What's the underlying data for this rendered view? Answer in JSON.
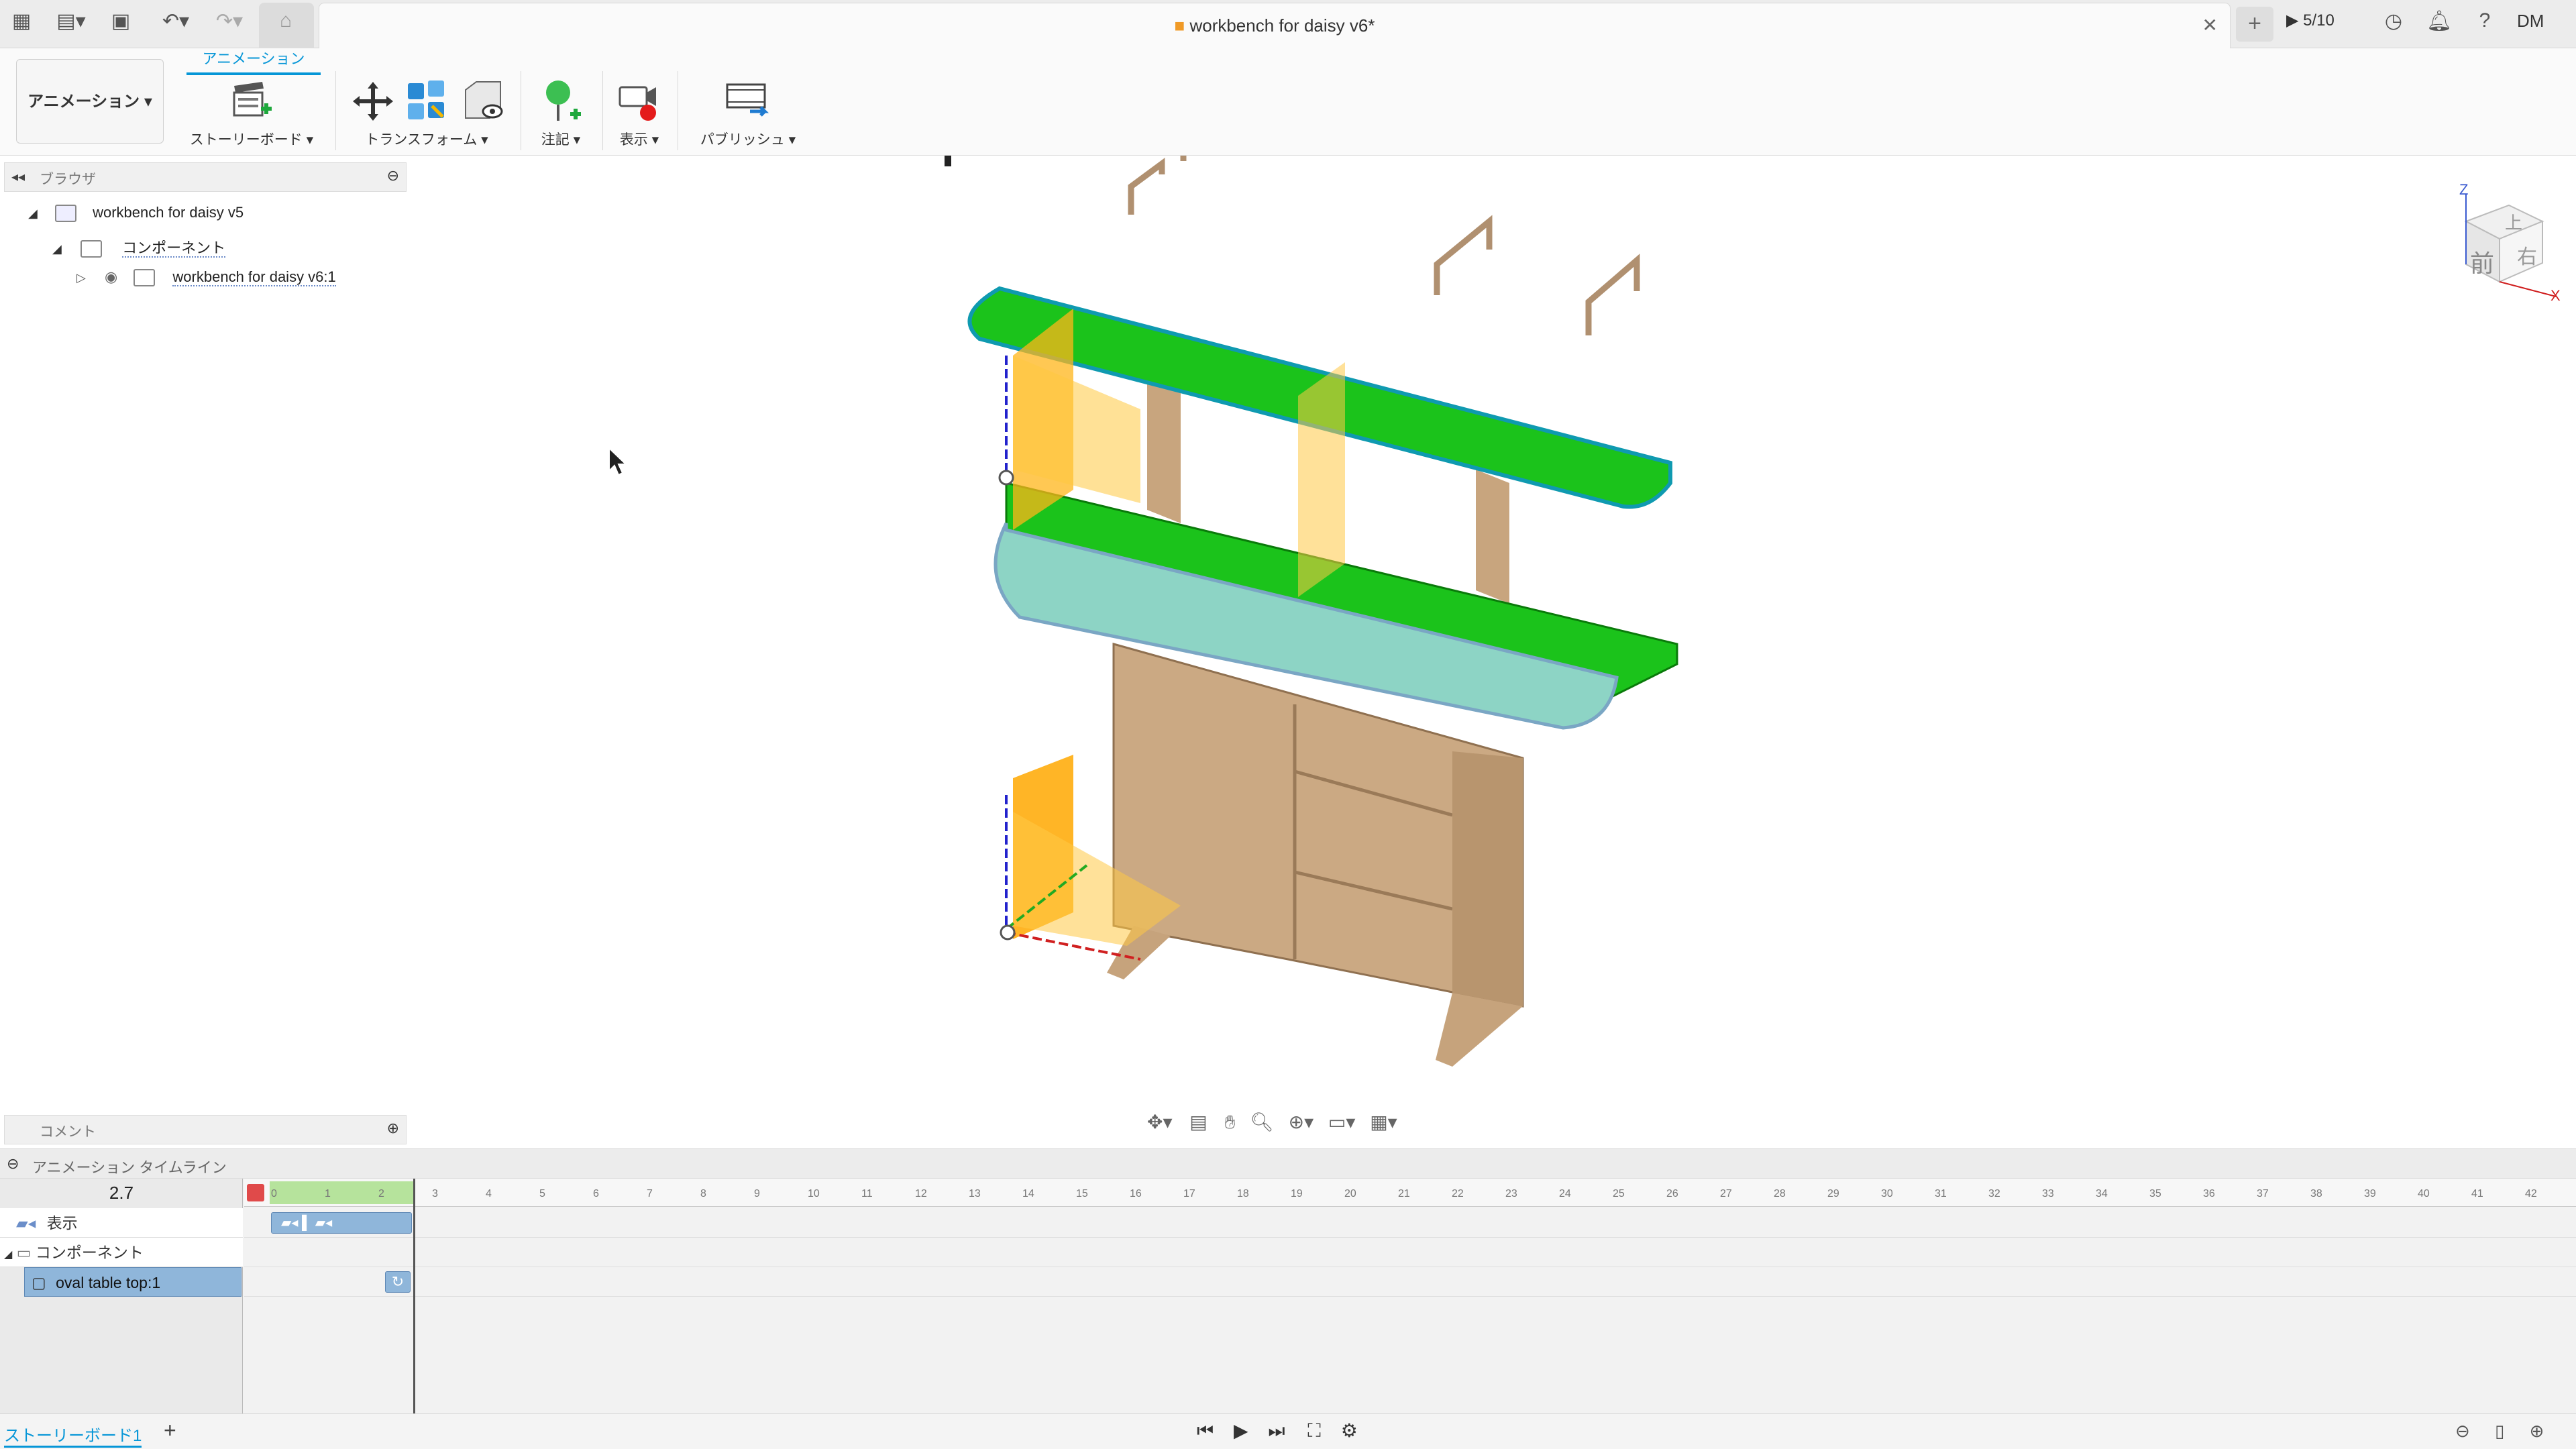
{
  "titlebar": {
    "doc_title": "workbench for daisy v6*",
    "job_status": "5/10",
    "user_initials": "DM",
    "icons": [
      "grid-icon",
      "file-icon",
      "save-icon",
      "undo-icon",
      "redo-icon",
      "home-icon",
      "close-icon",
      "plus-icon",
      "clock-icon",
      "bell-icon",
      "help-icon"
    ]
  },
  "ribbon": {
    "workspace": "アニメーション",
    "active_tab": "アニメーション",
    "groups": [
      {
        "label": "ストーリーボード",
        "icon": "storyboard-icon"
      },
      {
        "label": "トランスフォーム",
        "icon": "transform-icon"
      },
      {
        "label": "注記",
        "icon": "pin-icon"
      },
      {
        "label": "表示",
        "icon": "view-record-icon"
      },
      {
        "label": "パブリッシュ",
        "icon": "film-icon"
      }
    ]
  },
  "browser": {
    "title": "ブラウザ",
    "root": "workbench for daisy v5",
    "components": "コンポーネント",
    "child": "workbench for daisy v6:1"
  },
  "comments": {
    "title": "コメント"
  },
  "viewcube": {
    "top": "上",
    "front": "前",
    "right": "右",
    "axis_z": "Z",
    "axis_x": "X"
  },
  "timeline": {
    "title": "アニメーション タイムライン",
    "current_time": "2.7",
    "rows": [
      "表示",
      "コンポーネント",
      "oval table top:1"
    ],
    "ticks": [
      "0",
      "1",
      "2",
      "3",
      "4",
      "5",
      "6",
      "7",
      "8",
      "9",
      "10",
      "11",
      "12",
      "13",
      "14",
      "15",
      "16",
      "17",
      "18",
      "19",
      "20",
      "21",
      "22",
      "23",
      "24",
      "25",
      "26",
      "27",
      "28",
      "29",
      "30",
      "31",
      "32",
      "33",
      "34",
      "35",
      "36",
      "37",
      "38",
      "39",
      "40",
      "41",
      "42"
    ]
  },
  "status": {
    "storyboard_tab": "ストーリーボード1"
  },
  "colors": {
    "accent": "#0696d7",
    "green_top": "#00c400",
    "teal": "#8dd4c5",
    "wood": "#c9ab86",
    "orange": "#ffb61a"
  }
}
